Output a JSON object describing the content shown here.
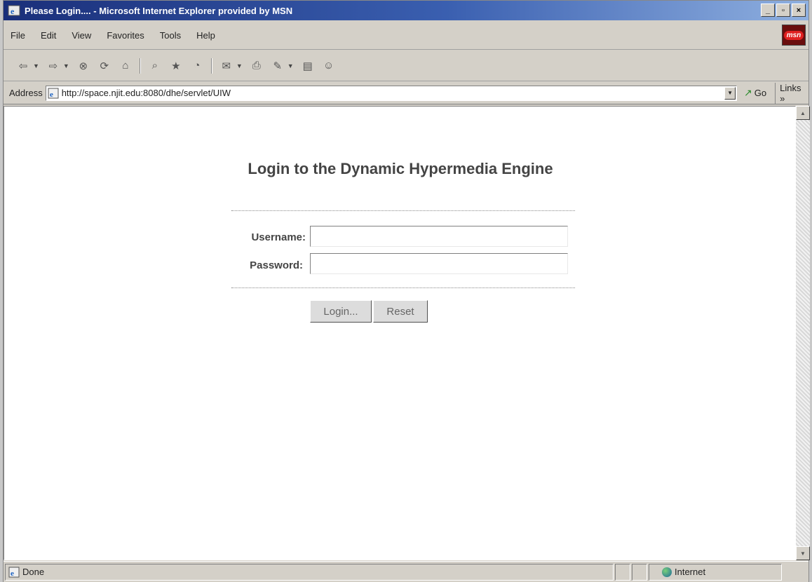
{
  "window": {
    "title": "Please Login.... - Microsoft Internet Explorer provided by MSN",
    "controls": {
      "minimize": "_",
      "maximize": "▫",
      "close": "×"
    }
  },
  "menu": {
    "items": [
      {
        "label": "File"
      },
      {
        "label": "Edit"
      },
      {
        "label": "View"
      },
      {
        "label": "Favorites"
      },
      {
        "label": "Tools"
      },
      {
        "label": "Help"
      }
    ],
    "brand_label": "msn"
  },
  "toolbar": {
    "icons": [
      "back-icon",
      "forward-icon",
      "stop-icon",
      "refresh-icon",
      "home-icon",
      "search-icon",
      "favorites-icon",
      "history-icon",
      "mail-icon",
      "print-icon",
      "edit-icon",
      "discuss-icon",
      "messenger-icon"
    ]
  },
  "address": {
    "label": "Address",
    "url": "http://space.njit.edu:8080/dhe/servlet/UIW",
    "go_label": "Go",
    "links_label": "Links »"
  },
  "page": {
    "heading": "Login to the Dynamic Hypermedia Engine",
    "username_label": "Username:",
    "username_value": "",
    "password_label": "Password:",
    "password_value": "",
    "login_button": "Login...",
    "reset_button": "Reset"
  },
  "status": {
    "text": "Done",
    "zone": "Internet"
  },
  "colors": {
    "title_gradient_start": "#1a2f7a",
    "title_gradient_end": "#8fb0e0",
    "chrome": "#d4d0c8",
    "heading_text": "#444444"
  }
}
